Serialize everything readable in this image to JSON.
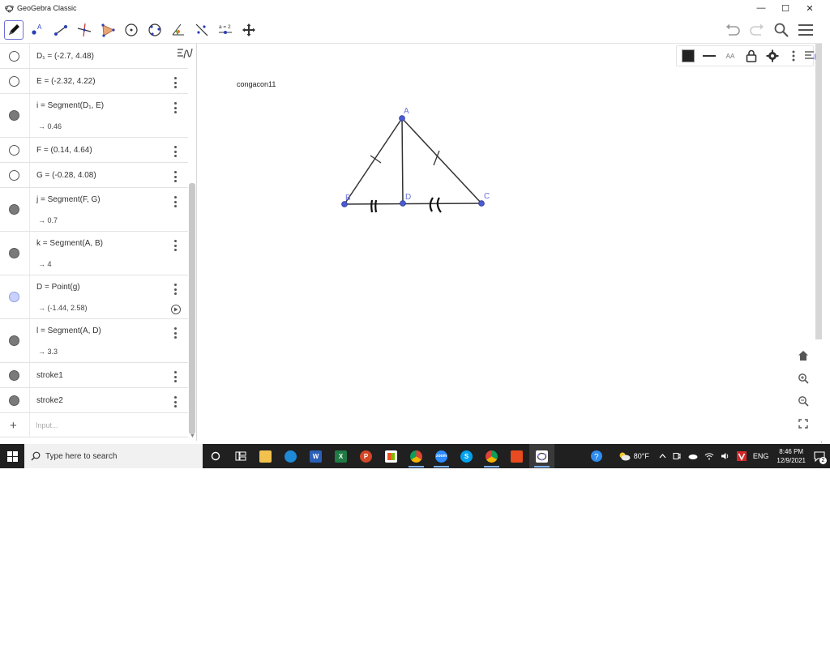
{
  "window": {
    "title": "GeoGebra Classic",
    "controls": {
      "minimize": "—",
      "maximize": "☐",
      "close": "✕"
    }
  },
  "toolbar": {
    "tools": [
      "pen-icon",
      "point-icon",
      "segment-icon",
      "perpendicular-line-icon",
      "polygon-icon",
      "circle-icon",
      "circle-through-points-icon",
      "angle-icon",
      "reflect-icon",
      "slider-icon",
      "move-graphics-icon"
    ],
    "slider_label": "a = 2",
    "right": [
      "undo-icon",
      "redo-icon",
      "search-icon",
      "menu-icon"
    ]
  },
  "algebra": {
    "rows": [
      {
        "def": "D₁ = (-2.7, 4.48)",
        "value": "",
        "dot": "empty"
      },
      {
        "def": "E = (-2.32, 4.22)",
        "value": "",
        "dot": "empty"
      },
      {
        "def": "i = Segment(D₁, E)",
        "value": "→ 0.46",
        "dot": "filled"
      },
      {
        "def": "F = (0.14, 4.64)",
        "value": "",
        "dot": "empty"
      },
      {
        "def": "G = (-0.28, 4.08)",
        "value": "",
        "dot": "empty"
      },
      {
        "def": "j = Segment(F, G)",
        "value": "→ 0.7",
        "dot": "filled"
      },
      {
        "def": "k = Segment(A, B)",
        "value": "→ 4",
        "dot": "filled"
      },
      {
        "def": "D = Point(g)",
        "value": "→ (-1.44, 2.58)",
        "dot": "blue"
      },
      {
        "def": "l = Segment(A, D)",
        "value": "→ 3.3",
        "dot": "filled"
      },
      {
        "def": "stroke1",
        "value": "",
        "dot": "filled"
      },
      {
        "def": "stroke2",
        "value": "",
        "dot": "filled"
      }
    ],
    "input_placeholder": "Input..."
  },
  "graphics": {
    "text_label": "congacon11",
    "points": {
      "A": "A",
      "B": "B",
      "C": "C",
      "D": "D"
    },
    "style_bar": {
      "text_size": "AA"
    },
    "colors": {
      "point": "#4a5bd4",
      "label": "#6a72d8",
      "line": "#333333"
    }
  },
  "taskbar": {
    "search_placeholder": "Type here to search",
    "weather": "80°F",
    "language": "ENG",
    "time": "8:46 PM",
    "date": "12/9/2021",
    "notifications": "2"
  }
}
